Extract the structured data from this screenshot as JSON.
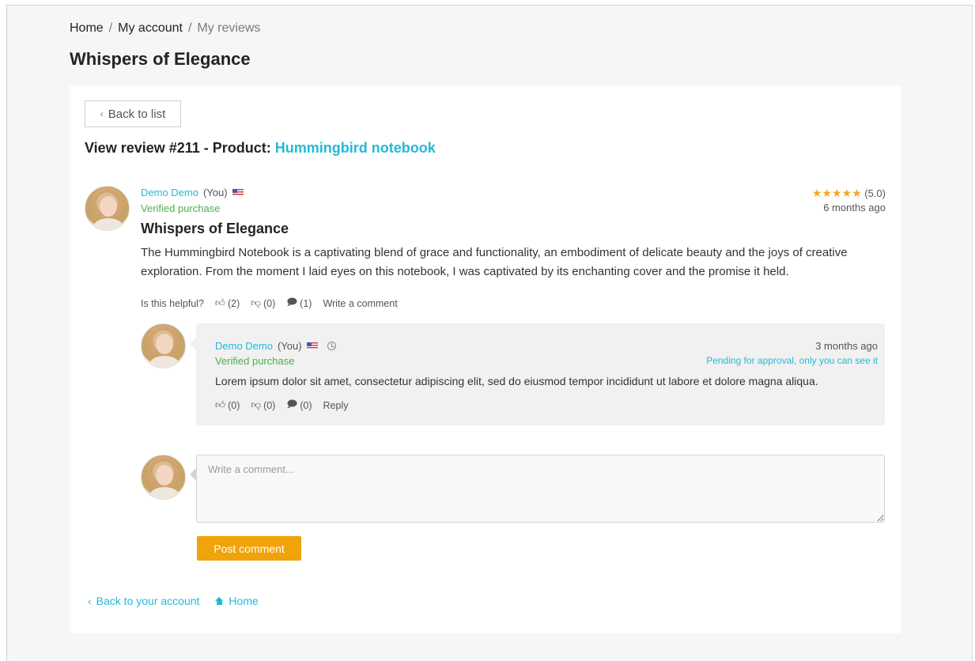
{
  "breadcrumb": {
    "home": "Home",
    "sep1": "/",
    "account": "My account",
    "sep2": "/",
    "current": "My reviews"
  },
  "page_title": "Whispers of Elegance",
  "back_button": {
    "label": "Back to list",
    "icon": "chevron-left-icon"
  },
  "view_title": {
    "prefix": "View review #211 - Product:",
    "product": "Hummingbird notebook"
  },
  "review": {
    "author": "Demo Demo",
    "you": "(You)",
    "verified": "Verified purchase",
    "stars": "★★★★★",
    "rating_text": "(5.0)",
    "rating_value": 5.0,
    "time": "6 months ago",
    "title": "Whispers of Elegance",
    "body": "The Hummingbird Notebook is a captivating blend of grace and functionality, an embodiment of delicate beauty and the joys of creative exploration. From the moment I laid eyes on this notebook, I was captivated by its enchanting cover and the promise it held.",
    "helpful_label": "Is this helpful?",
    "likes": "(2)",
    "dislikes": "(0)",
    "comments": "(1)",
    "write_comment": "Write a comment"
  },
  "comment": {
    "author": "Demo Demo",
    "you": "(You)",
    "verified": "Verified purchase",
    "time": "3 months ago",
    "pending": "Pending for approval, only you can see it",
    "text": "Lorem ipsum dolor sit amet, consectetur adipiscing elit, sed do eiusmod tempor incididunt ut labore et dolore magna aliqua.",
    "likes": "(0)",
    "dislikes": "(0)",
    "replies": "(0)",
    "reply_label": "Reply"
  },
  "new_comment": {
    "placeholder": "Write a comment...",
    "button": "Post comment"
  },
  "footer": {
    "back_account": "Back to your account",
    "home": "Home"
  },
  "colors": {
    "accent": "#24b9d7",
    "verified": "#4caf50",
    "button": "#f0a30a",
    "stars": "#f5a623"
  }
}
